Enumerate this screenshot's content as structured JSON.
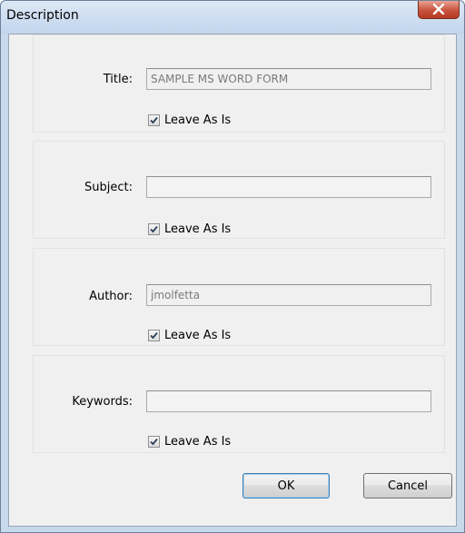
{
  "window": {
    "title": "Description",
    "close_glyph": "✕"
  },
  "fields": [
    {
      "key": "title",
      "label": "Title:",
      "value": "SAMPLE MS WORD FORM",
      "checkbox_label": "Leave As Is",
      "checked": true
    },
    {
      "key": "subject",
      "label": "Subject:",
      "value": "",
      "checkbox_label": "Leave As Is",
      "checked": true
    },
    {
      "key": "author",
      "label": "Author:",
      "value": "jmolfetta",
      "checkbox_label": "Leave As Is",
      "checked": true
    },
    {
      "key": "keywords",
      "label": "Keywords:",
      "value": "",
      "checkbox_label": "Leave As Is",
      "checked": true
    }
  ],
  "buttons": {
    "ok_label": "OK",
    "cancel_label": "Cancel"
  },
  "colors": {
    "titlebar": "#c2d5ec",
    "close_button": "#c8533d",
    "dialog_background": "#f0f0f0"
  }
}
